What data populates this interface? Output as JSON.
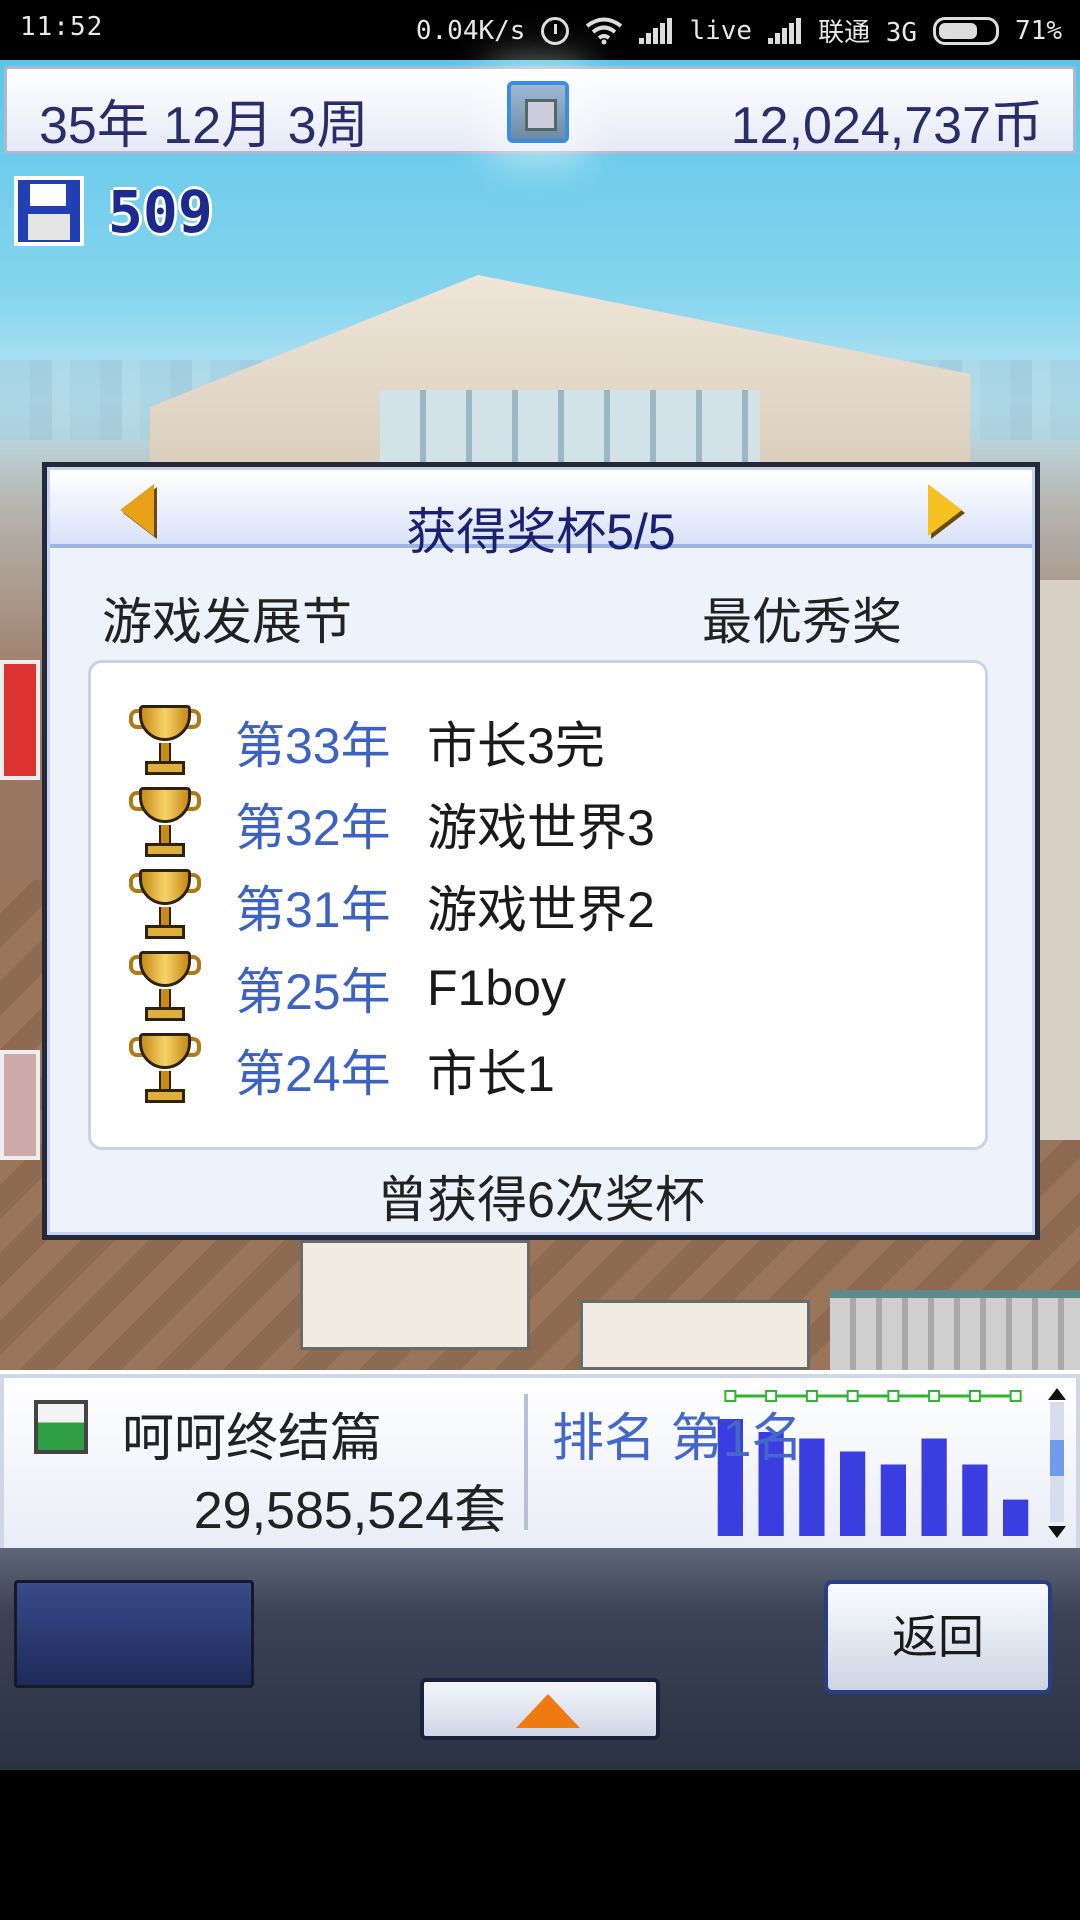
{
  "status_bar": {
    "time": "11:52",
    "net_speed": "0.04K/s",
    "network_label": "live",
    "carrier": "联通 3G",
    "battery": "71%"
  },
  "hud": {
    "date": "35年 12月 3周",
    "money": "12,024,737币",
    "save_count": "509"
  },
  "dialog": {
    "title": "获得奖杯5/5",
    "event_name": "游戏发展节",
    "award_name": "最优秀奖",
    "trophies": [
      {
        "year": "第33年",
        "game": "市长3完"
      },
      {
        "year": "第32年",
        "game": "游戏世界3"
      },
      {
        "year": "第31年",
        "game": "游戏世界2"
      },
      {
        "year": "第25年",
        "game": "F1boy"
      },
      {
        "year": "第24年",
        "game": "市长1"
      }
    ],
    "total": "曾获得6次奖杯"
  },
  "info_bar": {
    "game_title": "呵呵终结篇",
    "sales": "29,585,524套",
    "rank_label": "排名 第1名"
  },
  "chart_data": {
    "type": "bar",
    "categories": [
      "",
      "",
      "",
      "",
      "",
      "",
      "",
      ""
    ],
    "values": [
      9,
      8,
      7.5,
      6.5,
      5.5,
      7.5,
      5.5,
      2.8
    ],
    "ylim": [
      0,
      10
    ],
    "colors": {
      "bar": "#3a3de0",
      "marker_line": "#2fb52f"
    }
  },
  "controls": {
    "back_label": "返回"
  },
  "colors": {
    "title_text": "#1c2070",
    "year_text": "#3d63c2",
    "rank_text": "#4567c9",
    "arrow": "#f5c122",
    "expand_arrow": "#f07a12"
  }
}
